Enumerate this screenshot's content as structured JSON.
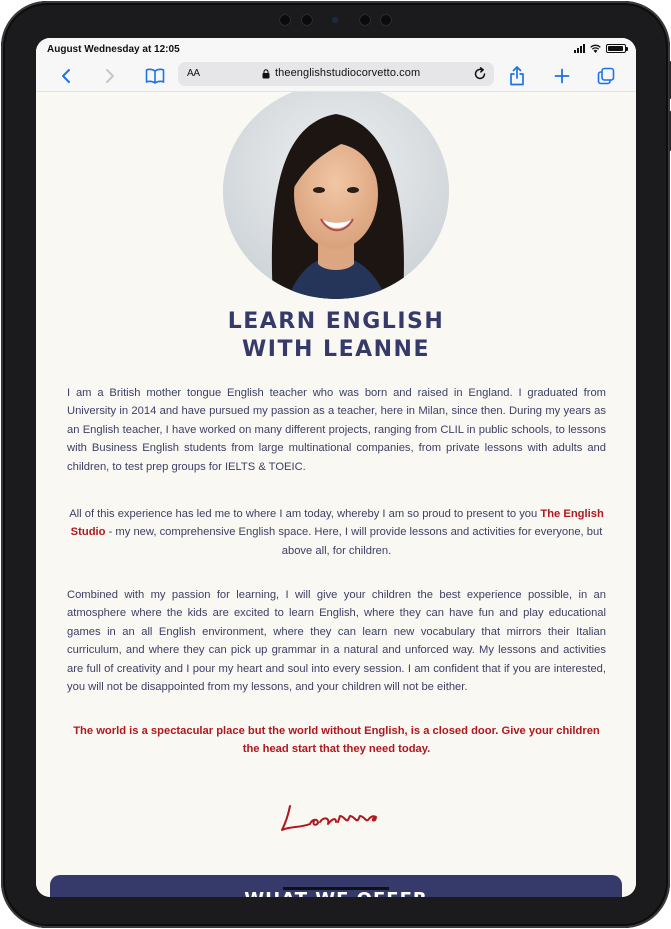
{
  "statusbar": {
    "time": "August Wednesday at 12:05",
    "battery_level": 0.95
  },
  "browser": {
    "aa_label": "AA",
    "url": "theenglishstudiocorvetto.com",
    "icons": {
      "back": "chevron-left-icon",
      "forward": "chevron-right-icon",
      "bookmarks": "book-icon",
      "lock": "lock-icon",
      "reload": "reload-icon",
      "share": "share-icon",
      "new_tab": "plus-icon",
      "tabs": "tabs-icon"
    },
    "accent_color": "#1a73e8"
  },
  "hero": {
    "heading_line1": "LEARN ENGLISH",
    "heading_line2": "WITH LEANNE",
    "heading_color": "#363a6a"
  },
  "content": {
    "p1": "I am a British mother tongue English teacher who was born and raised in England. I graduated from University in 2014 and have pursued my passion as a teacher, here in Milan, since then. During my years as an English teacher, I have worked on many different projects, ranging from CLIL in public schools, to lessons with Business English students from large multinational companies, from private lessons with adults and children, to test prep groups for IELTS & TOEIC.",
    "p2_before": "All of this experience has led me to where I am today, whereby I am so proud to present to you ",
    "p2_highlight": "The English Studio",
    "p2_after": " - my new, comprehensive English space. Here, I will provide lessons and activities for everyone, but above all, for children.",
    "p3": "Combined with my passion for learning, I will give your children the best experience possible, in an atmosphere where the kids are excited to learn English, where they can have fun and play educational games in an all English environment, where they can learn new vocabulary that mirrors their Italian curriculum, and where they can pick up grammar in a natural and unforced way. My lessons and activities are full of creativity and I pour my heart and soul into every session. I am confident that if you are interested, you will not be disappointed from my lessons, and your children will not be either.",
    "quote": "The world is a spectacular place but the world without English, is a closed door. Give your children the head start that they need today.",
    "accent_color": "#b0171e",
    "signature": "Leanne"
  },
  "offer": {
    "title": "WHAT WE OFFER",
    "bg_color": "#363a6a"
  }
}
